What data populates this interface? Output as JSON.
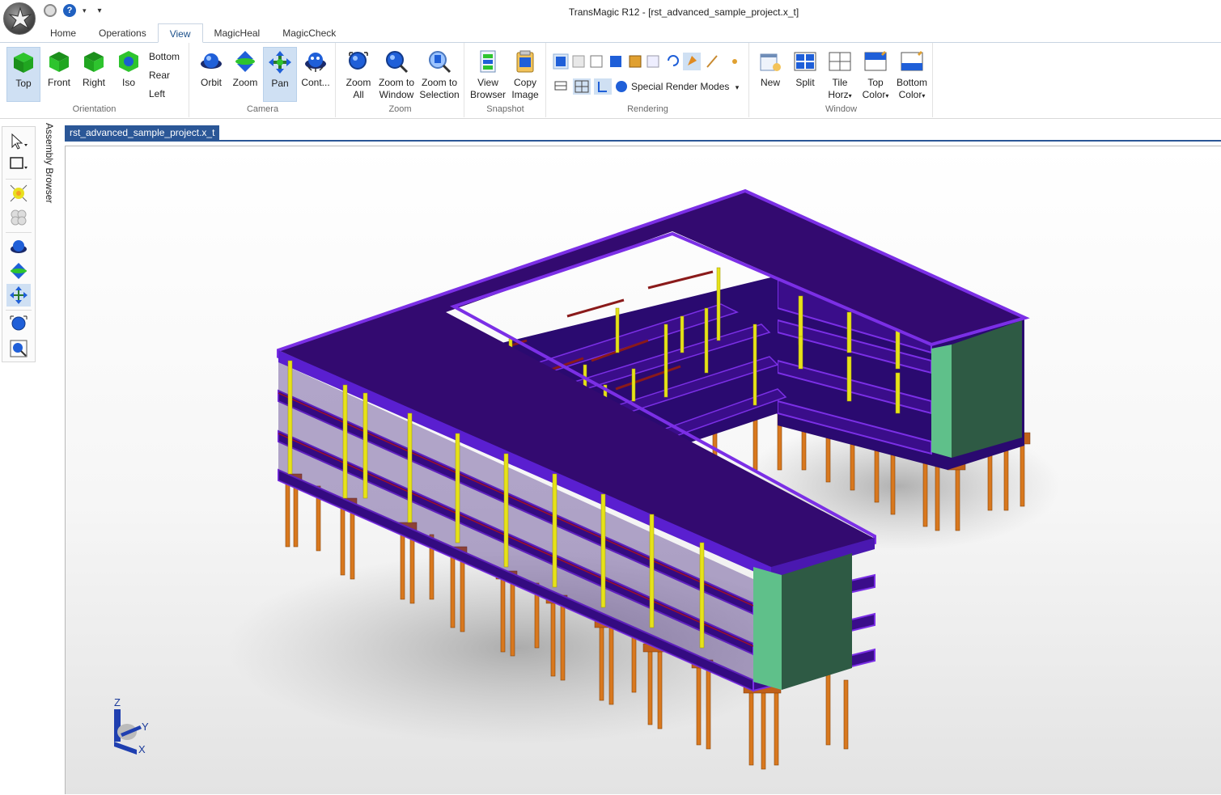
{
  "window": {
    "title": "TransMagic R12 - [rst_advanced_sample_project.x_t]"
  },
  "ribbon_tabs": [
    "Home",
    "Operations",
    "View",
    "MagicHeal",
    "MagicCheck"
  ],
  "active_tab": "View",
  "groups": {
    "orientation": {
      "label": "Orientation",
      "buttons": [
        "Top",
        "Front",
        "Right",
        "Iso"
      ],
      "small_items": [
        "Bottom",
        "Rear",
        "Left"
      ],
      "selected": "Top"
    },
    "camera": {
      "label": "Camera",
      "buttons": [
        "Orbit",
        "Zoom",
        "Pan",
        "Cont..."
      ],
      "selected": "Pan"
    },
    "zoom": {
      "label": "Zoom",
      "buttons": [
        [
          "Zoom",
          "All"
        ],
        [
          "Zoom to",
          "Window"
        ],
        [
          "Zoom to",
          "Selection"
        ]
      ]
    },
    "snapshot": {
      "label": "Snapshot",
      "buttons": [
        [
          "View",
          "Browser"
        ],
        [
          "Copy",
          "Image"
        ]
      ]
    },
    "rendering": {
      "label": "Rendering",
      "special_render_modes": "Special Render Modes"
    },
    "window": {
      "label": "Window",
      "buttons": [
        [
          "New",
          ""
        ],
        [
          "Split",
          ""
        ],
        [
          "Tile",
          "Horz"
        ],
        [
          "Top",
          "Color"
        ],
        [
          "Bottom",
          "Color"
        ]
      ]
    }
  },
  "sidebar": {
    "assembly_browser": "Assembly Browser"
  },
  "document_tab": "rst_advanced_sample_project.x_t",
  "triad": {
    "z": "Z",
    "y": "Y",
    "x": "X"
  },
  "colors": {
    "slab": "#3a0d8a",
    "slab_edge": "#7b2fe6",
    "column": "#e6e21a",
    "pile": "#d8781e",
    "core_light": "#5fc08a",
    "core_dark": "#2e5a44",
    "ribbon_selected": "#cfe0f3",
    "doc_tab": "#2b5797"
  }
}
